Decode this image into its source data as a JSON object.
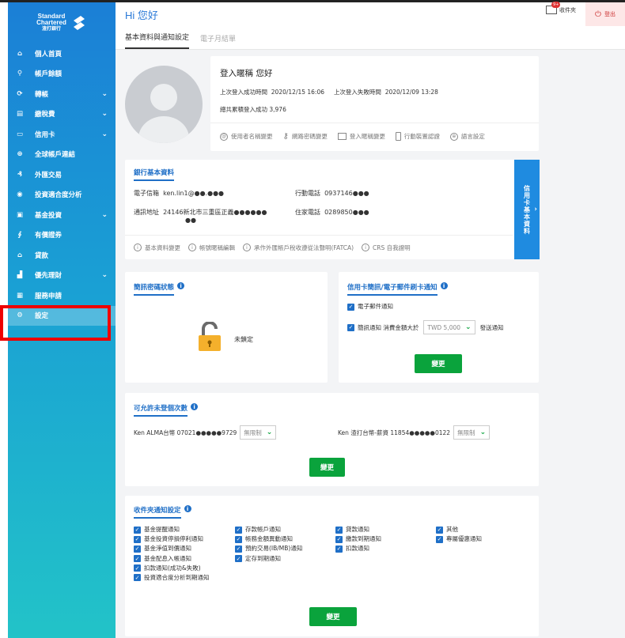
{
  "sidebar": {
    "logo_line1": "Standard",
    "logo_line2": "Chartered",
    "logo_line3": "渣打銀行",
    "items": [
      {
        "label": "個人首頁",
        "icon": "home-icon",
        "chevron": false
      },
      {
        "label": "帳戶餘額",
        "icon": "user-icon",
        "chevron": false
      },
      {
        "label": "轉帳",
        "icon": "transfer-icon",
        "chevron": true
      },
      {
        "label": "繳稅費",
        "icon": "bill-icon",
        "chevron": true
      },
      {
        "label": "信用卡",
        "icon": "credit-card-icon",
        "chevron": true
      },
      {
        "label": "全球帳戶連結",
        "icon": "globe-icon",
        "chevron": false
      },
      {
        "label": "外匯交易",
        "icon": "currency-icon",
        "chevron": false
      },
      {
        "label": "投資適合度分析",
        "icon": "analysis-icon",
        "chevron": false
      },
      {
        "label": "基金投資",
        "icon": "fund-icon",
        "chevron": true
      },
      {
        "label": "有價證券",
        "icon": "securities-icon",
        "chevron": false
      },
      {
        "label": "貸款",
        "icon": "loan-icon",
        "chevron": false
      },
      {
        "label": "優先理財",
        "icon": "priority-icon",
        "chevron": true
      },
      {
        "label": "服務申請",
        "icon": "service-icon",
        "chevron": false
      },
      {
        "label": "設定",
        "icon": "settings-gear-icon",
        "chevron": false
      }
    ]
  },
  "header": {
    "greeting": "Hi 您好",
    "inbox_label": "收件夾",
    "inbox_count": "9+",
    "logout_label": "登出"
  },
  "tabs": [
    {
      "label": "基本資料與通知設定",
      "active": true
    },
    {
      "label": "電子月結單",
      "active": false
    }
  ],
  "profile": {
    "nickname": "登入暱稱  您好",
    "last_success_label": "上次登入成功時間",
    "last_success_value": "2020/12/15 16:06",
    "last_fail_label": "上次登入失敗時間",
    "last_fail_value": "2020/12/09 13:28",
    "total_logins": "總共累積登入成功  3,976",
    "links": [
      "使用者名稱變更",
      "網路密碼變更",
      "登入暱稱變更",
      "行動裝置認證",
      "語言設定"
    ]
  },
  "basic_info": {
    "title": "銀行基本資料",
    "email_label": "電子信箱",
    "email_value": "ken.lin1@●●.●●●",
    "mobile_label": "行動電話",
    "mobile_value": "0937146●●●",
    "address_label": "通訊地址",
    "address_value": "24146新北市三重區正義●●●●●●",
    "address_value2": "●●",
    "home_label": "住家電話",
    "home_value": "0289850●●●",
    "links": [
      "基本資料變更",
      "帳號暱稱編輯",
      "承作外匯帳戶稅收遵從法聲明(FATCA)",
      "CRS 自我證明"
    ],
    "side_tab": "信用卡基本資料"
  },
  "sms_lock": {
    "title": "簡訊密碼狀態",
    "status": "未鎖定"
  },
  "card_notify": {
    "title": "信用卡簡訊/電子郵件刷卡通知",
    "email_notify": "電子郵件通知",
    "sms_notify": "簡訊通知  消費金額大於",
    "amount": "TWD 5,000",
    "send_suffix": "發送通知",
    "button": "變更"
  },
  "non_designated": {
    "title": "可允許未登個次數",
    "acct1": "Ken ALMA台幣  07021●●●●●9729",
    "acct1_value": "無限制",
    "acct2": "Ken 渣打台幣-薪資  11854●●●●●0122",
    "acct2_value": "無限制",
    "button": "變更"
  },
  "inbox_notify": {
    "title": "收件夾通知設定",
    "col1": [
      "基金提醒通知",
      "基金投資停損停利通知",
      "基金淨值到價通知",
      "基金配息入帳通知",
      "扣款通知(成功&失敗)",
      "投資適合度分析到期通知"
    ],
    "col2": [
      "存款帳戶通知",
      "帳務金額異動通知",
      "預約交易(IB/MB)通知",
      "定存到期通知"
    ],
    "col3": [
      "貸款通知",
      "繳款到期通知",
      "扣款通知"
    ],
    "col4": [
      "其他",
      "專屬優惠通知"
    ],
    "button": "變更"
  },
  "colors": {
    "accent": "#1f6fc7",
    "green": "#0aa33c",
    "highlight": "#ee0000"
  }
}
